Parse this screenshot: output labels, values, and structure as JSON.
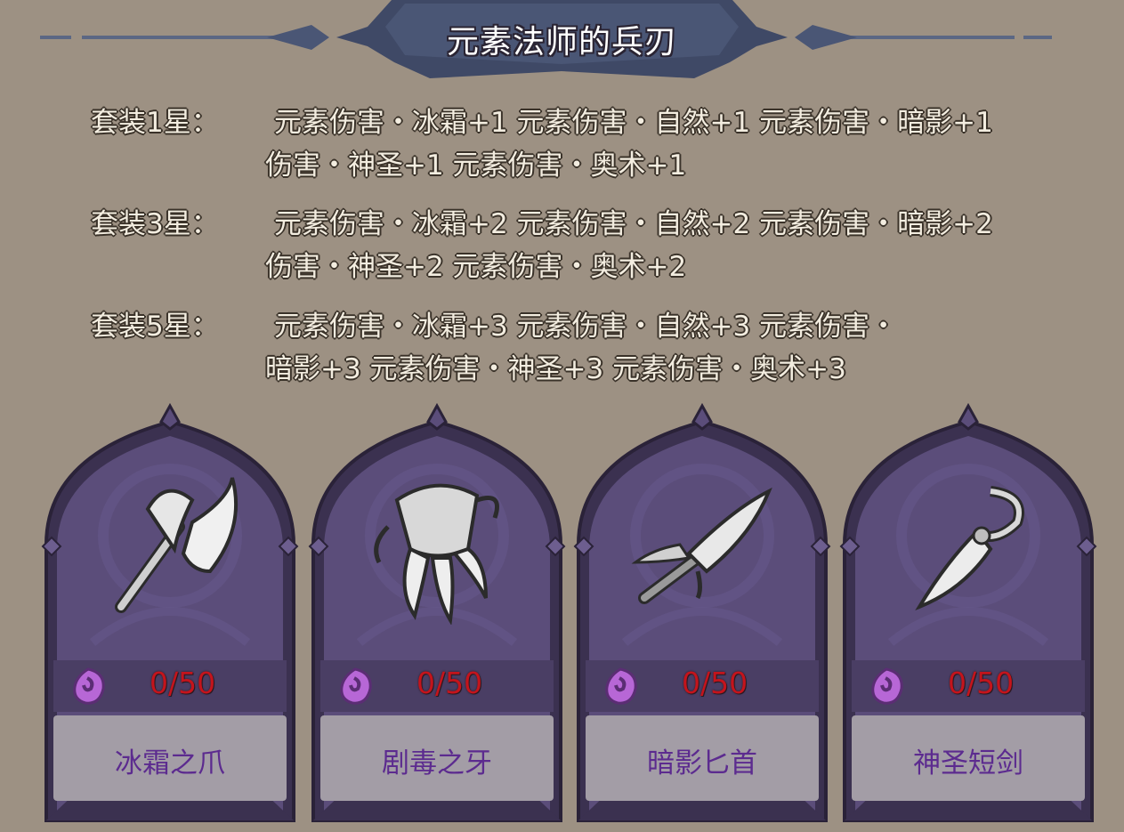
{
  "title": "元素法师的兵刃",
  "set_bonuses": [
    {
      "label": "套装1星：",
      "line1": "元素伤害・冰霜+1 元素伤害・自然+1 元素伤害・暗影+1",
      "line2": "伤害・神圣+1 元素伤害・奥术+1"
    },
    {
      "label": "套装3星：",
      "line1": "元素伤害・冰霜+2 元素伤害・自然+2 元素伤害・暗影+2",
      "line2": "伤害・神圣+2 元素伤害・奥术+2"
    },
    {
      "label": "套装5星：",
      "line1": "元素伤害・冰霜+3 元素伤害・自然+3 元素伤害・",
      "line2": "暗影+3 元素伤害・神圣+3 元素伤害・奥术+3"
    }
  ],
  "items": [
    {
      "name": "冰霜之爪",
      "count": "0/50",
      "icon": "axe-icon"
    },
    {
      "name": "剧毒之牙",
      "count": "0/50",
      "icon": "claw-icon"
    },
    {
      "name": "暗影匕首",
      "count": "0/50",
      "icon": "dagger-icon"
    },
    {
      "name": "神圣短剑",
      "count": "0/50",
      "icon": "short-sword-icon"
    }
  ],
  "colors": {
    "background": "#9d9183",
    "card_frame": "#4d4164",
    "count_red": "#c4141c",
    "name_purple": "#5c2b8f",
    "gem_purple": "#b767d6"
  }
}
